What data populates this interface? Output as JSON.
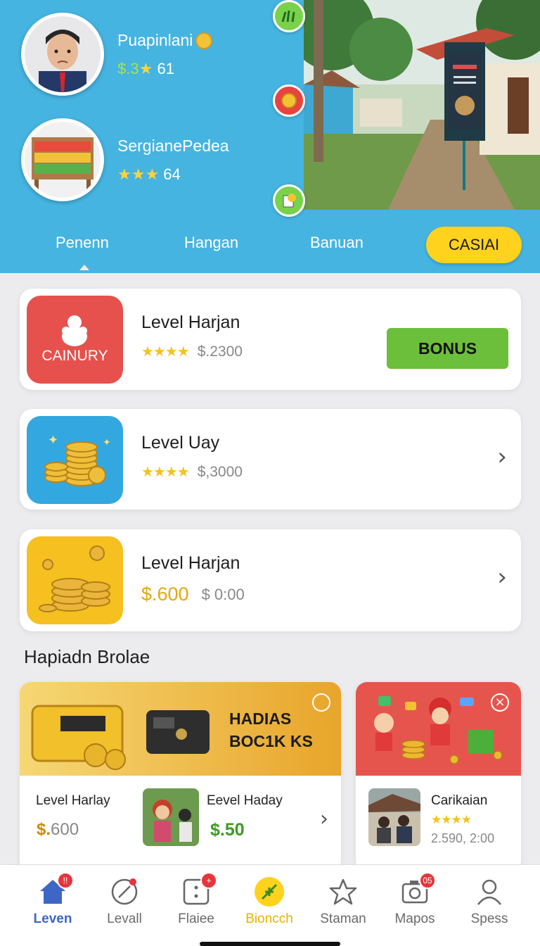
{
  "header": {
    "profiles": [
      {
        "name": "Puapinlani",
        "stat_money": "$.3",
        "stat_value": "61",
        "stars": "★"
      },
      {
        "name": "SergianePedea",
        "stars": "★★★",
        "stat_value": "64"
      }
    ],
    "tabs": [
      "Penenn",
      "Hangan",
      "Banuan"
    ],
    "action_button": "CASIAI"
  },
  "cards": [
    {
      "title": "Level Harjan",
      "stars": "★★★★",
      "amount": "$.2300",
      "thumb_label": "CAINURY",
      "button": "BONUS"
    },
    {
      "title": "Level Uay",
      "stars": "★★★★",
      "amount": "$,3000"
    },
    {
      "title": "Level Harjan",
      "price": "$.600",
      "amount": "$ 0:00"
    }
  ],
  "section": {
    "title": "Hapiadn Brolae"
  },
  "promo_main": {
    "banner_line1": "HADIAS",
    "banner_line2": "BOC1K KS",
    "item1_title": "Level Harlay",
    "item1_price_symbol": "$.",
    "item1_price": "600",
    "item2_title": "Eevel Haday",
    "item2_price": "$.50"
  },
  "promo_side": {
    "title": "Carikaian",
    "stars": "★★★★",
    "subtitle": "2.590, 2:00"
  },
  "nav": [
    {
      "label": "Leven",
      "icon": "home-icon",
      "badge": "!!"
    },
    {
      "label": "Levall",
      "icon": "compass-icon"
    },
    {
      "label": "Flaiee",
      "icon": "dice-icon",
      "badge": "+"
    },
    {
      "label": "Bioncch",
      "icon": "leaf-icon"
    },
    {
      "label": "Staman",
      "icon": "star-icon"
    },
    {
      "label": "Mapos",
      "icon": "camera-icon",
      "badge": "05"
    },
    {
      "label": "Spess",
      "icon": "person-icon"
    }
  ],
  "colors": {
    "header_bg": "#45b4e1",
    "accent_yellow": "#ffd21d",
    "bonus_green": "#6cbf3a",
    "active_nav": "#3e66c6",
    "active_nav_alt": "#e9b400"
  }
}
